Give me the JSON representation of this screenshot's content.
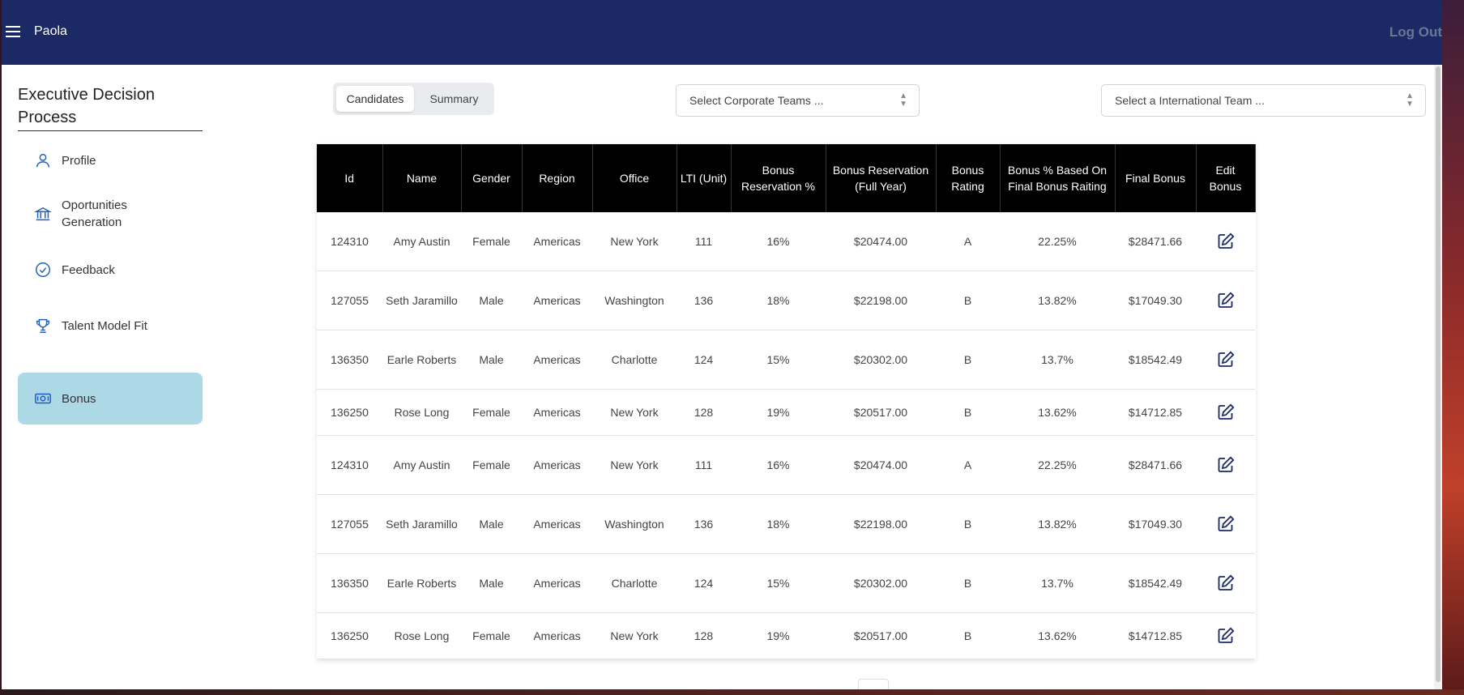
{
  "header": {
    "user_name": "Paola",
    "logout_label": "Log Out"
  },
  "sidebar": {
    "title": "Executive Decision Process",
    "items": [
      {
        "label": "Profile",
        "icon": "user-icon",
        "active": false
      },
      {
        "label": "Oportunities Generation",
        "icon": "bank-icon",
        "active": false
      },
      {
        "label": "Feedback",
        "icon": "check-circle-icon",
        "active": false
      },
      {
        "label": "Talent Model Fit",
        "icon": "trophy-icon",
        "active": false
      },
      {
        "label": "Bonus",
        "icon": "money-icon",
        "active": true
      }
    ]
  },
  "tabs": [
    {
      "label": "Candidates",
      "active": true
    },
    {
      "label": "Summary",
      "active": false
    }
  ],
  "filters": {
    "corporate_placeholder": "Select Corporate Teams ...",
    "international_placeholder": "Select a International Team ..."
  },
  "table": {
    "columns": [
      "Id",
      "Name",
      "Gender",
      "Region",
      "Office",
      "LTI (Unit)",
      "Bonus Reservation %",
      "Bonus Reservation (Full Year)",
      "Bonus Rating",
      "Bonus % Based On Final Bonus Raiting",
      "Final Bonus",
      "Edit Bonus"
    ],
    "rows": [
      [
        "124310",
        "Amy Austin",
        "Female",
        "Americas",
        "New York",
        "111",
        "16%",
        "$20474.00",
        "A",
        "22.25%",
        "$28471.66"
      ],
      [
        "127055",
        "Seth Jaramillo",
        "Male",
        "Americas",
        "Washington",
        "136",
        "18%",
        "$22198.00",
        "B",
        "13.82%",
        "$17049.30"
      ],
      [
        "136350",
        "Earle Roberts",
        "Male",
        "Americas",
        "Charlotte",
        "124",
        "15%",
        "$20302.00",
        "B",
        "13.7%",
        "$18542.49"
      ],
      [
        "136250",
        "Rose Long",
        "Female",
        "Americas",
        "New York",
        "128",
        "19%",
        "$20517.00",
        "B",
        "13.62%",
        "$14712.85"
      ],
      [
        "124310",
        "Amy Austin",
        "Female",
        "Americas",
        "New York",
        "111",
        "16%",
        "$20474.00",
        "A",
        "22.25%",
        "$28471.66"
      ],
      [
        "127055",
        "Seth Jaramillo",
        "Male",
        "Americas",
        "Washington",
        "136",
        "18%",
        "$22198.00",
        "B",
        "13.82%",
        "$17049.30"
      ],
      [
        "136350",
        "Earle Roberts",
        "Male",
        "Americas",
        "Charlotte",
        "124",
        "15%",
        "$20302.00",
        "B",
        "13.7%",
        "$18542.49"
      ],
      [
        "136250",
        "Rose Long",
        "Female",
        "Americas",
        "New York",
        "128",
        "19%",
        "$20517.00",
        "B",
        "13.62%",
        "$14712.85"
      ]
    ]
  },
  "colors": {
    "topbar": "#1b2a64",
    "active_nav": "#add8e6",
    "table_header": "#000000",
    "icon_blue": "#1f5fbf"
  }
}
